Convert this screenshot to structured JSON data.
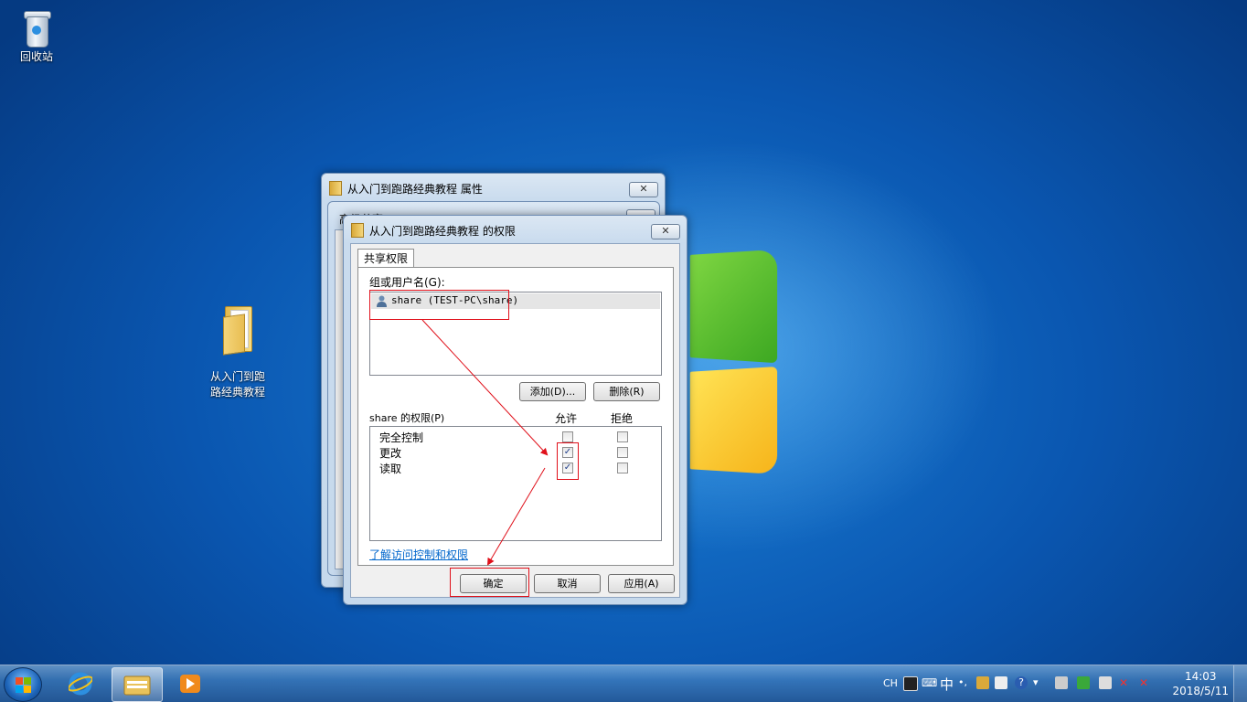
{
  "desktop": {
    "icons": [
      {
        "label": "回收站"
      },
      {
        "label": "从入门到跑\n路经典教程"
      }
    ]
  },
  "properties_window": {
    "title": "从入门到跑路经典教程 属性",
    "close": "✕",
    "inner_title": "高级共享"
  },
  "permissions_dialog": {
    "title": "从入门到跑路经典教程 的权限",
    "close": "✕",
    "tab_label": "共享权限",
    "group_label": "组或用户名(G):",
    "users": [
      {
        "name": "share (TEST-PC\\share)"
      }
    ],
    "add_button": "添加(D)...",
    "remove_button": "删除(R)",
    "perm_label": "share 的权限(P)",
    "allow_header": "允许",
    "deny_header": "拒绝",
    "permissions": [
      {
        "name": "完全控制",
        "allow": false,
        "deny": false
      },
      {
        "name": "更改",
        "allow": true,
        "deny": false
      },
      {
        "name": "读取",
        "allow": true,
        "deny": false
      }
    ],
    "learn_link": "了解访问控制和权限",
    "ok_button": "确定",
    "cancel_button": "取消",
    "apply_button": "应用(A)"
  },
  "taskbar": {
    "language": "CH",
    "ime_char": "中",
    "time": "14:03",
    "date": "2018/5/11",
    "accent": "#1d64b8"
  }
}
